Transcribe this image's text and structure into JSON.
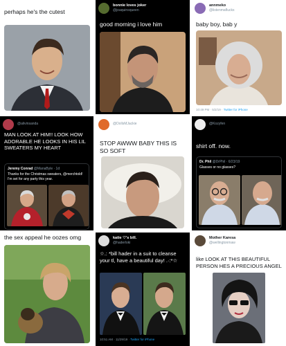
{
  "tiles": [
    {
      "text": "perhaps he's the cutest"
    },
    {
      "name": "bonnie loves joker",
      "handle": "@joaquinsqueen",
      "text": "good morning i love him"
    },
    {
      "name": "annmeko",
      "handle": "@listenmaflucks",
      "text": "baby boy,  bab y",
      "meta_time": "10:49 PM · 5/2/19 ·",
      "meta_link": "Twitter for iPhone"
    },
    {
      "handle": "@alivinsanda",
      "text": "MAN LOOK AT HIM!! LOOK HOW ADORABLE HE LOOKS IN HIS LIL SWEATERS MY HEART",
      "quote": {
        "name": "Jeremy Conrad",
        "handle": "@ManaByle · 1d",
        "text": "Thanks for the Christmas sweaters, @merchtold! I'm set for any party this year."
      }
    },
    {
      "handle": "@DollsMJackie",
      "text": "STOP AWWW BABY THIS IS SO SOFT"
    },
    {
      "handle": "@Kozyfen",
      "text": "shirt off. now.",
      "quote": {
        "name": "Dr. Phil",
        "handle": "@DrPhil · 6/23/19",
        "text": "Glasses or no glasses?"
      }
    },
    {
      "text": "the sex appeal he oozes omg"
    },
    {
      "name": "katie ♡'s bill.",
      "handle": "@haderloki",
      "text": "☆.: *bill hader in a suit to cleanse your tl, have a beautiful day! .·:*☆",
      "meta_time": "10:51 AM · 11/29/19 ·",
      "meta_link": "Twitter for iPhone"
    },
    {
      "name": "Mother Karesa",
      "handle": "@wellingtonmaw",
      "text": "like LOOK AT THIS BEAUTIFUL PERSON HES A PRECIOUS ANGEL"
    }
  ],
  "colors": {
    "accent": "#1da1f2",
    "muted": "#8899a6",
    "dark_bg": "#000000",
    "light_bg": "#ffffff"
  }
}
